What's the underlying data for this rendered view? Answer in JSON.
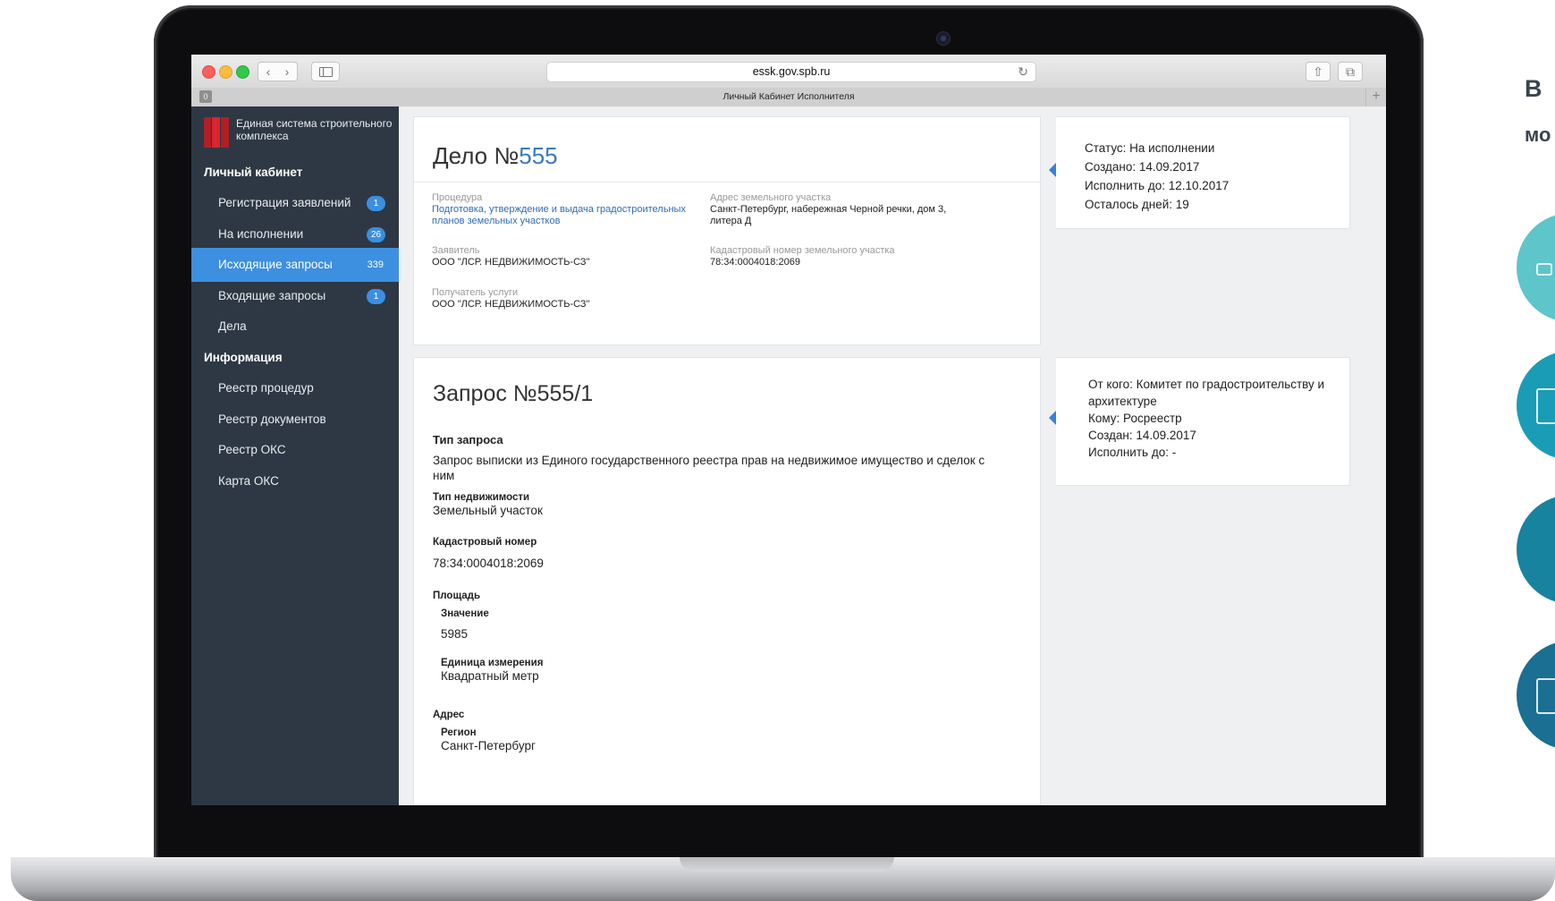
{
  "browser": {
    "url": "essk.gov.spb.ru",
    "tab_title": "Личный Кабинет Исполнителя"
  },
  "sidebar": {
    "brand": "Единая система строительного комплекса",
    "section_cabinet": "Личный кабинет",
    "section_info": "Информация",
    "items": [
      {
        "label": "Регистрация заявлений",
        "badge": "1"
      },
      {
        "label": "На исполнении",
        "badge": "26"
      },
      {
        "label": "Исходящие запросы",
        "badge": "339",
        "active": true
      },
      {
        "label": "Входящие запросы",
        "badge": "1"
      },
      {
        "label": "Дела",
        "badge": ""
      }
    ],
    "info_items": [
      {
        "label": "Реестр процедур"
      },
      {
        "label": "Реестр документов"
      },
      {
        "label": "Реестр ОКС"
      },
      {
        "label": "Карта ОКС"
      }
    ]
  },
  "case": {
    "title_prefix": "Дело №",
    "number": "555",
    "procedure_label": "Процедура",
    "procedure_value": "Подготовка, утверждение и выдача градостроительных планов земельных участков",
    "address_label": "Адрес земельного участка",
    "address_value": "Санкт-Петербург, набережная Черной речки, дом 3, литера Д",
    "applicant_label": "Заявитель",
    "applicant_value": "ООО \"ЛСР. НЕДВИЖИМОСТЬ-СЗ\"",
    "cadastral_label": "Кадастровый номер земельного участка",
    "cadastral_value": "78:34:0004018:2069",
    "recipient_label": "Получатель услуги",
    "recipient_value": "ООО \"ЛСР. НЕДВИЖИМОСТЬ-СЗ\""
  },
  "status": {
    "status": "Статус: На исполнении",
    "created": "Создано: 14.09.2017",
    "due": "Исполнить до: 12.10.2017",
    "days_left": "Осталось дней: 19"
  },
  "request": {
    "title": "Запрос №555/1",
    "type_head": "Тип запроса",
    "type_value": "Запрос выписки из Единого государственного реестра прав на недвижимое имущество и сделок с ним",
    "property_head": "Тип недвижимости",
    "property_value": "Земельный участок",
    "cadastral_head": "Кадастровый номер",
    "cadastral_value": "78:34:0004018:2069",
    "area_head": "Площадь",
    "value_head": "Значение",
    "value_value": "5985",
    "unit_head": "Единица измерения",
    "unit_value": "Квадратный метр",
    "address_head": "Адрес",
    "region_head": "Регион",
    "region_value": "Санкт-Петербург"
  },
  "request_info": {
    "from": "От кого: Комитет по градостроительству и архитектуре",
    "to": "Кому: Росреестр",
    "created": "Создан: 14.09.2017",
    "due": "Исполнить до: -"
  },
  "page_side": {
    "heading": "В",
    "sub": "мо"
  },
  "colors": {
    "sidebar_bg": "#2d3844",
    "accent_blue": "#3b7fd6",
    "link_blue": "#2f6db5",
    "logo_red": "#d8262e"
  }
}
